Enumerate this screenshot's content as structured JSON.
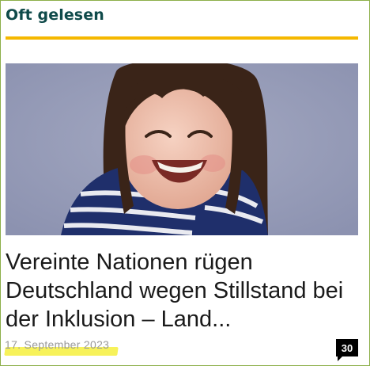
{
  "widget": {
    "title": "Oft gelesen"
  },
  "article": {
    "headline": "Vereinte Nationen rügen Deutschland wegen Stillstand bei der Inklusion – Land...",
    "date": "17. September 2023",
    "comment_count": "30",
    "image_icon": "smiling-girl-photo"
  },
  "colors": {
    "accent_rule": "#f5b800",
    "title_color": "#0f4a4a",
    "highlight": "#f7f25a",
    "image_background": "#8f96b4"
  }
}
